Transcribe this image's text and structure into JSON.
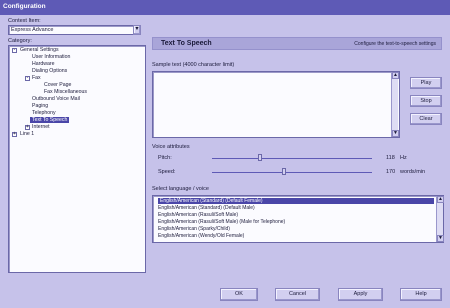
{
  "window": {
    "title": "Configuration"
  },
  "left": {
    "context_label": "Context Item:",
    "context_value": "Express Advance",
    "category_label": "Category:",
    "tree": [
      "General Settings",
      "User Information",
      "Hardware",
      "Dialing Options",
      "Fax",
      "Cover Page",
      "Fax Miscellaneous",
      "Outbound Voice Mail",
      "Paging",
      "Telephony",
      "Text To Speech",
      "Internet",
      "Line 1"
    ]
  },
  "header": {
    "title": "Text To Speech",
    "subtitle": "Configure the text-to-speech settings"
  },
  "sample": {
    "label": "Sample text (4000 character limit)",
    "value": "",
    "buttons": {
      "play": "Play",
      "stop": "Stop",
      "clear": "Clear"
    }
  },
  "voice_attributes": {
    "label": "Voice attributes",
    "pitch_label": "Pitch:",
    "pitch_value": "118",
    "pitch_unit": "Hz",
    "pitch_level": 0.3,
    "speed_label": "Speed:",
    "speed_value": "170",
    "speed_unit": "words/min",
    "speed_level": 0.45
  },
  "voices": {
    "label": "Select language / voice",
    "items": [
      "English/American (Standard) (Default Female)",
      "English/American (Standard) (Default Male)",
      "English/American (Rasuli/Soft Male)",
      "English/American (Rasuli/Soft Male) (Male for Telephone)",
      "English/American (Sparky/Child)",
      "English/American (Wendy/Old Female)"
    ],
    "selected_index": 0
  },
  "footer": {
    "ok": "OK",
    "cancel": "Cancel",
    "apply": "Apply",
    "help": "Help"
  }
}
